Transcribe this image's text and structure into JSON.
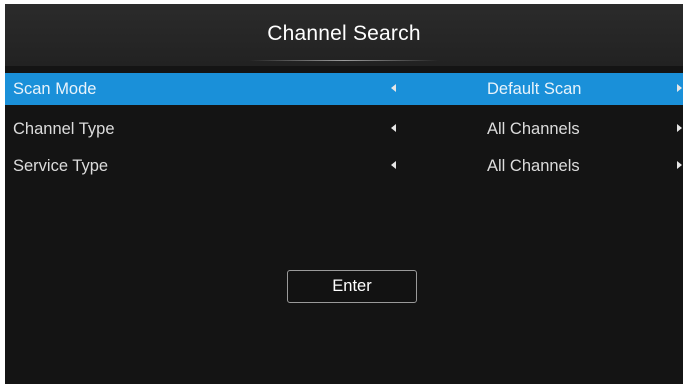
{
  "header": {
    "title": "Channel Search"
  },
  "settings": [
    {
      "label": "Scan Mode",
      "value": "Default Scan",
      "selected": true
    },
    {
      "label": "Channel Type",
      "value": "All Channels",
      "selected": false
    },
    {
      "label": "Service Type",
      "value": "All Channels",
      "selected": false
    }
  ],
  "actions": {
    "enter_label": "Enter"
  },
  "colors": {
    "highlight": "#1a90d9",
    "panel_background": "#141414",
    "title_background": "#262626",
    "text": "#dcdcdc"
  },
  "icons": {
    "decrease": "triangle-left-icon",
    "increase": "triangle-right-icon"
  }
}
